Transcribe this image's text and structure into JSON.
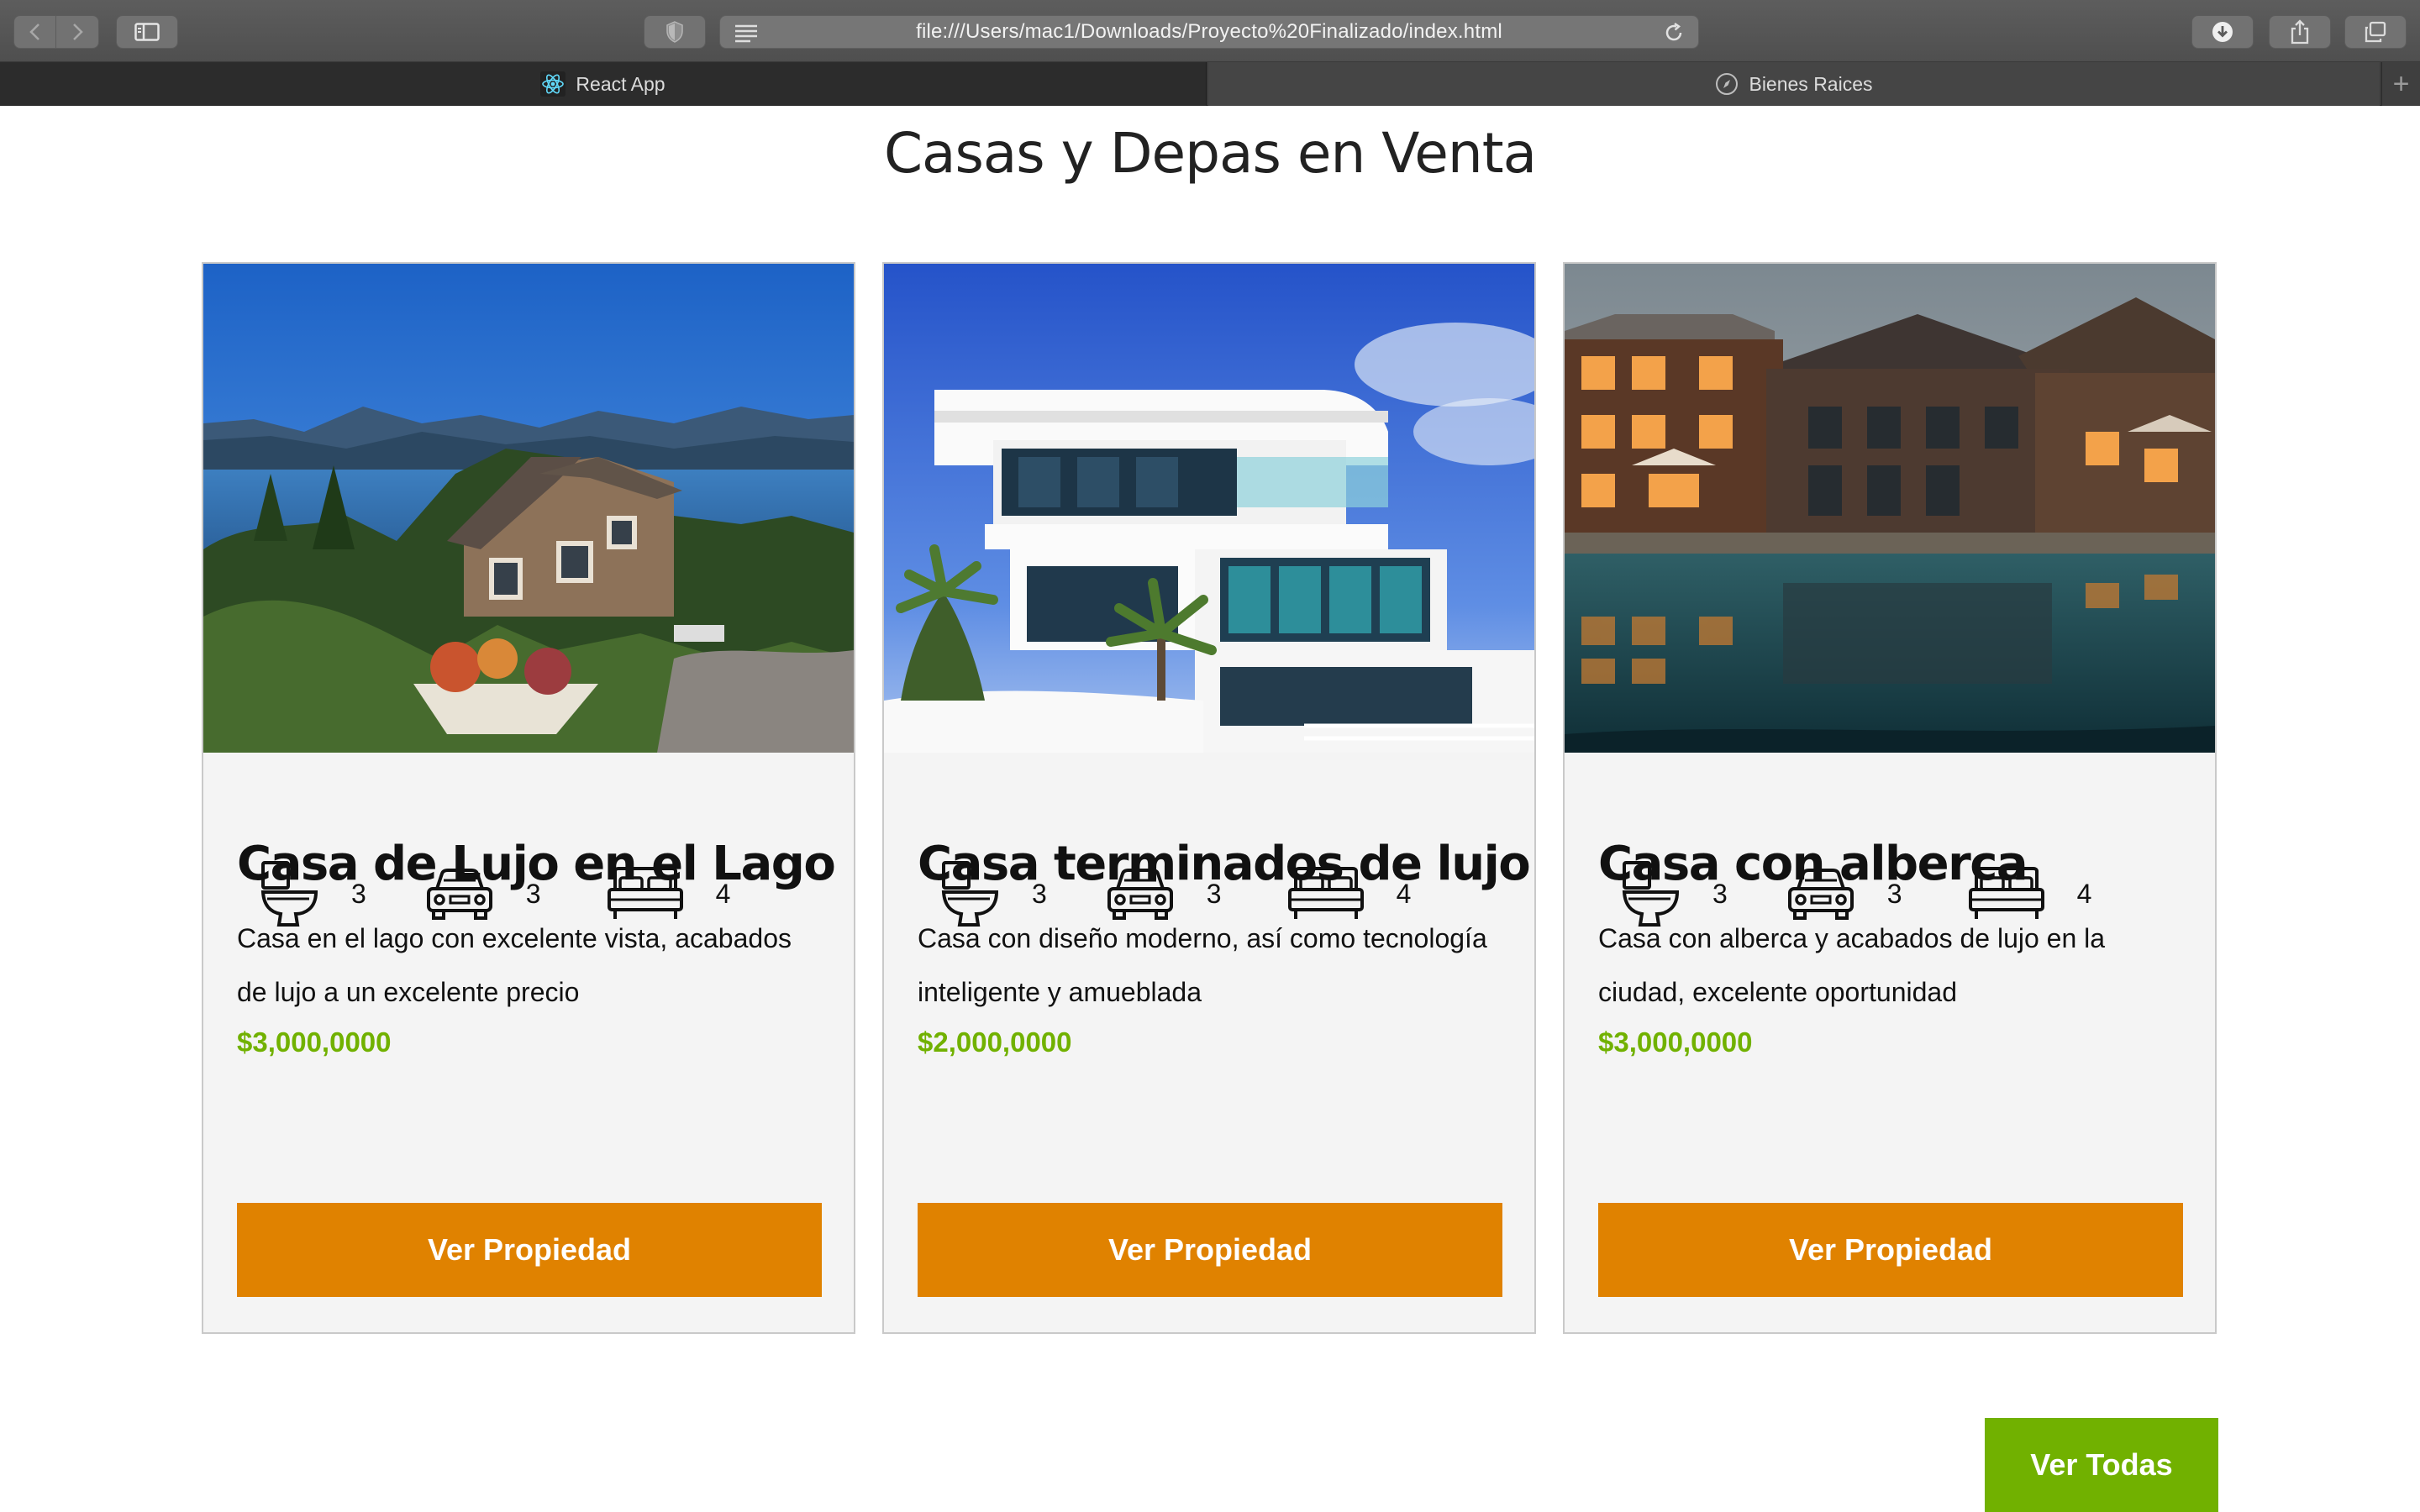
{
  "browser": {
    "url": "file:///Users/mac1/Downloads/Proyecto%20Finalizado/index.html",
    "tabs": [
      {
        "label": "React App",
        "icon": "react-icon"
      },
      {
        "label": "Bienes Raices",
        "icon": "compass-icon"
      }
    ],
    "new_tab_glyph": "+"
  },
  "page": {
    "title": "Casas y Depas en Venta",
    "colors": {
      "accent_orange": "#e08200",
      "accent_green": "#71b100",
      "card_bg": "#f4f4f4"
    },
    "cards": [
      {
        "title": "Casa de Lujo en el Lago",
        "description": "Casa en el lago con excelente vista, acabados de lujo a un excelente precio",
        "price": "$3,000,0000",
        "bathrooms": "3",
        "parking": "3",
        "bedrooms": "4",
        "button": "Ver Propiedad"
      },
      {
        "title": "Casa terminados de lujo",
        "description": "Casa con diseño moderno, así como tecnología inteligente y amueblada",
        "price": "$2,000,0000",
        "bathrooms": "3",
        "parking": "3",
        "bedrooms": "4",
        "button": "Ver Propiedad"
      },
      {
        "title": "Casa con alberca",
        "description": "Casa con alberca y acabados de lujo en la ciudad, excelente oportunidad",
        "price": "$3,000,0000",
        "bathrooms": "3",
        "parking": "3",
        "bedrooms": "4",
        "button": "Ver Propiedad"
      }
    ],
    "view_all": "Ver Todas"
  }
}
